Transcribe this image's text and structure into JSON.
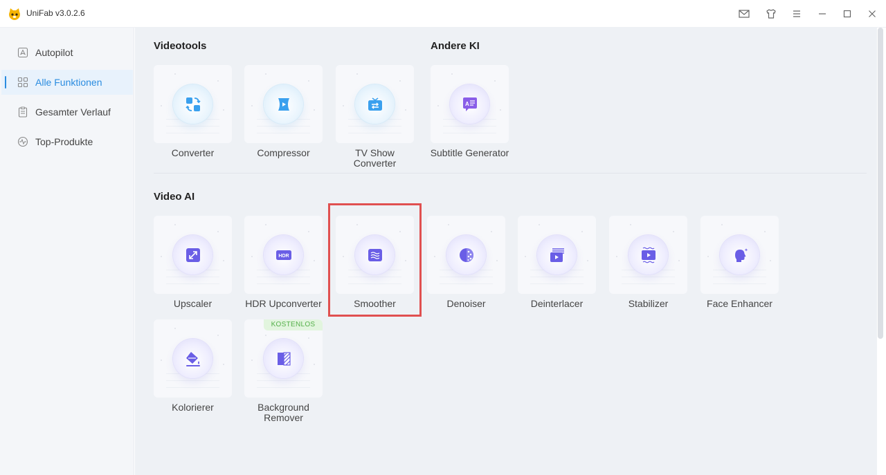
{
  "app": {
    "title": "UniFab v3.0.2.6"
  },
  "titlebar_icons": [
    "mail-icon",
    "shirt-icon",
    "menu-icon",
    "minimize-icon",
    "maximize-icon",
    "close-icon"
  ],
  "sidebar": {
    "items": [
      {
        "label": "Autopilot",
        "icon": "autopilot-icon",
        "active": false
      },
      {
        "label": "Alle Funktionen",
        "icon": "grid-icon",
        "active": true
      },
      {
        "label": "Gesamter Verlauf",
        "icon": "history-icon",
        "active": false
      },
      {
        "label": "Top-Produkte",
        "icon": "top-products-icon",
        "active": false
      }
    ]
  },
  "sections": {
    "videotools": {
      "title": "Videotools",
      "tools": [
        {
          "label": "Converter",
          "icon": "converter-icon"
        },
        {
          "label": "Compressor",
          "icon": "compressor-icon"
        },
        {
          "label": "TV Show\nConverter",
          "icon": "tv-show-converter-icon"
        }
      ]
    },
    "andere_ki": {
      "title": "Andere KI",
      "tools": [
        {
          "label": "Subtitle Generator",
          "icon": "subtitle-generator-icon"
        }
      ]
    },
    "video_ai": {
      "title": "Video AI",
      "tools": [
        {
          "label": "Upscaler",
          "icon": "upscaler-icon"
        },
        {
          "label": "HDR Upconverter",
          "icon": "hdr-icon",
          "icon_text": "HDR"
        },
        {
          "label": "Smoother",
          "icon": "smoother-icon",
          "highlighted": true
        },
        {
          "label": "Denoiser",
          "icon": "denoiser-icon"
        },
        {
          "label": "Deinterlacer",
          "icon": "deinterlacer-icon"
        },
        {
          "label": "Stabilizer",
          "icon": "stabilizer-icon"
        },
        {
          "label": "Face Enhancer",
          "icon": "face-enhancer-icon"
        },
        {
          "label": "Kolorierer",
          "icon": "colorizer-icon"
        },
        {
          "label": "Background\nRemover",
          "icon": "background-remover-icon",
          "badge": "KOSTENLOS"
        }
      ]
    }
  },
  "colors": {
    "accent": "#2a8ce0",
    "blue_icon": "#3aa0ee",
    "purple_icon": "#6a5ee6",
    "highlight_border": "#e05050",
    "badge_bg": "#e2f5de",
    "badge_text": "#55b04a"
  }
}
